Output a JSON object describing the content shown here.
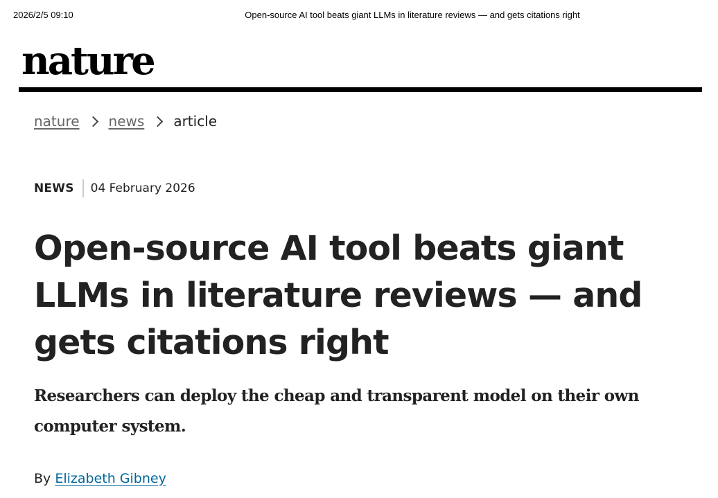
{
  "print_header": {
    "datetime": "2026/2/5 09:10",
    "page_title": "Open-source AI tool beats giant LLMs in literature reviews — and gets citations right"
  },
  "masthead": {
    "logo_text": "nature"
  },
  "breadcrumb": {
    "items": [
      {
        "label": "nature",
        "link": true
      },
      {
        "label": "news",
        "link": true
      },
      {
        "label": "article",
        "link": false
      }
    ]
  },
  "article": {
    "type": "NEWS",
    "date": "04 February 2026",
    "title": "Open-source AI tool beats giant LLMs in literature reviews — and gets citations right",
    "standfirst": "Researchers can deploy the cheap and transparent model on their own computer system.",
    "byline_prefix": "By",
    "author": "Elizabeth Gibney"
  },
  "colors": {
    "link_blue": "#006699",
    "text": "#222222",
    "crumb_gray": "#666666",
    "rule": "#000000"
  }
}
